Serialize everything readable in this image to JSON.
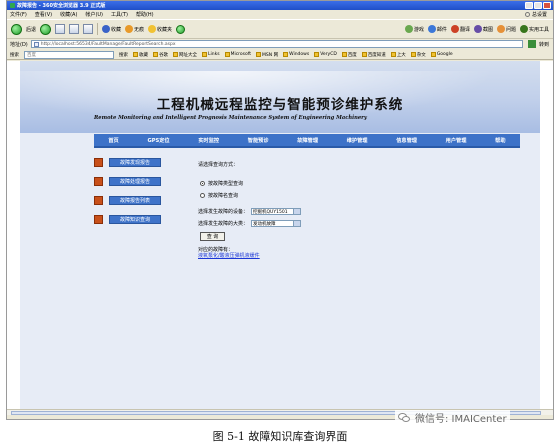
{
  "window": {
    "title": "故障报告 - 360安全浏览器 3.9 正式版"
  },
  "menu": {
    "items": [
      "文件(F)",
      "查看(V)",
      "收藏(A)",
      "帐户(U)",
      "工具(T)",
      "帮助(H)"
    ],
    "right_link": "总设置"
  },
  "toolbar": {
    "back": "后退",
    "fav": "收藏",
    "unsafe": "无痕",
    "favorites": "收藏夹",
    "items": [
      "游戏",
      "邮件",
      "翻译",
      "截图",
      "问题",
      "实用工具"
    ]
  },
  "address": {
    "label": "地址(D)",
    "url": "http://localhost:56534/FaultManage/FaultReportSearch.aspx",
    "go": "转到"
  },
  "favbar": {
    "label": "搜索",
    "search_placeholder": "百度",
    "search_btn": "搜索",
    "items": [
      "收藏",
      "谷歌",
      "网址大全",
      "Links",
      "Microsoft",
      "MSN 网",
      "Windows",
      "VeryCD",
      "百度",
      "百度知道",
      "上大",
      "杂文",
      "Google"
    ]
  },
  "banner": {
    "title": "工程机械远程监控与智能预诊维护系统",
    "subtitle": "Remote Monitoring and Intelligent Prognosis Maintenance System of Engineering Machinery"
  },
  "nav": [
    "首页",
    "GPS定位",
    "实时监控",
    "智能预诊",
    "故障管理",
    "维护管理",
    "信息管理",
    "用户管理",
    "帮助"
  ],
  "sidebar": [
    "故障发现报告",
    "故障处理报告",
    "故障报告列表",
    "故障知识查询"
  ],
  "form": {
    "query_mode_label": "请选择查询方式：",
    "options": [
      "按故障类型查询",
      "按故障名查询"
    ],
    "device_label": "选择发生故障的设备：",
    "device_value": "挖掘机QUY1501",
    "major_label": "选择发生故障的大类：",
    "major_value": "发动机故障",
    "query_btn": "查 询",
    "result_label": "对应的故障有：",
    "result_link": "液氧泵化/酸液压弹机液缓件"
  },
  "watermark": "微信号: IMAICenter",
  "caption": "图 5-1  故障知识库查询界面"
}
